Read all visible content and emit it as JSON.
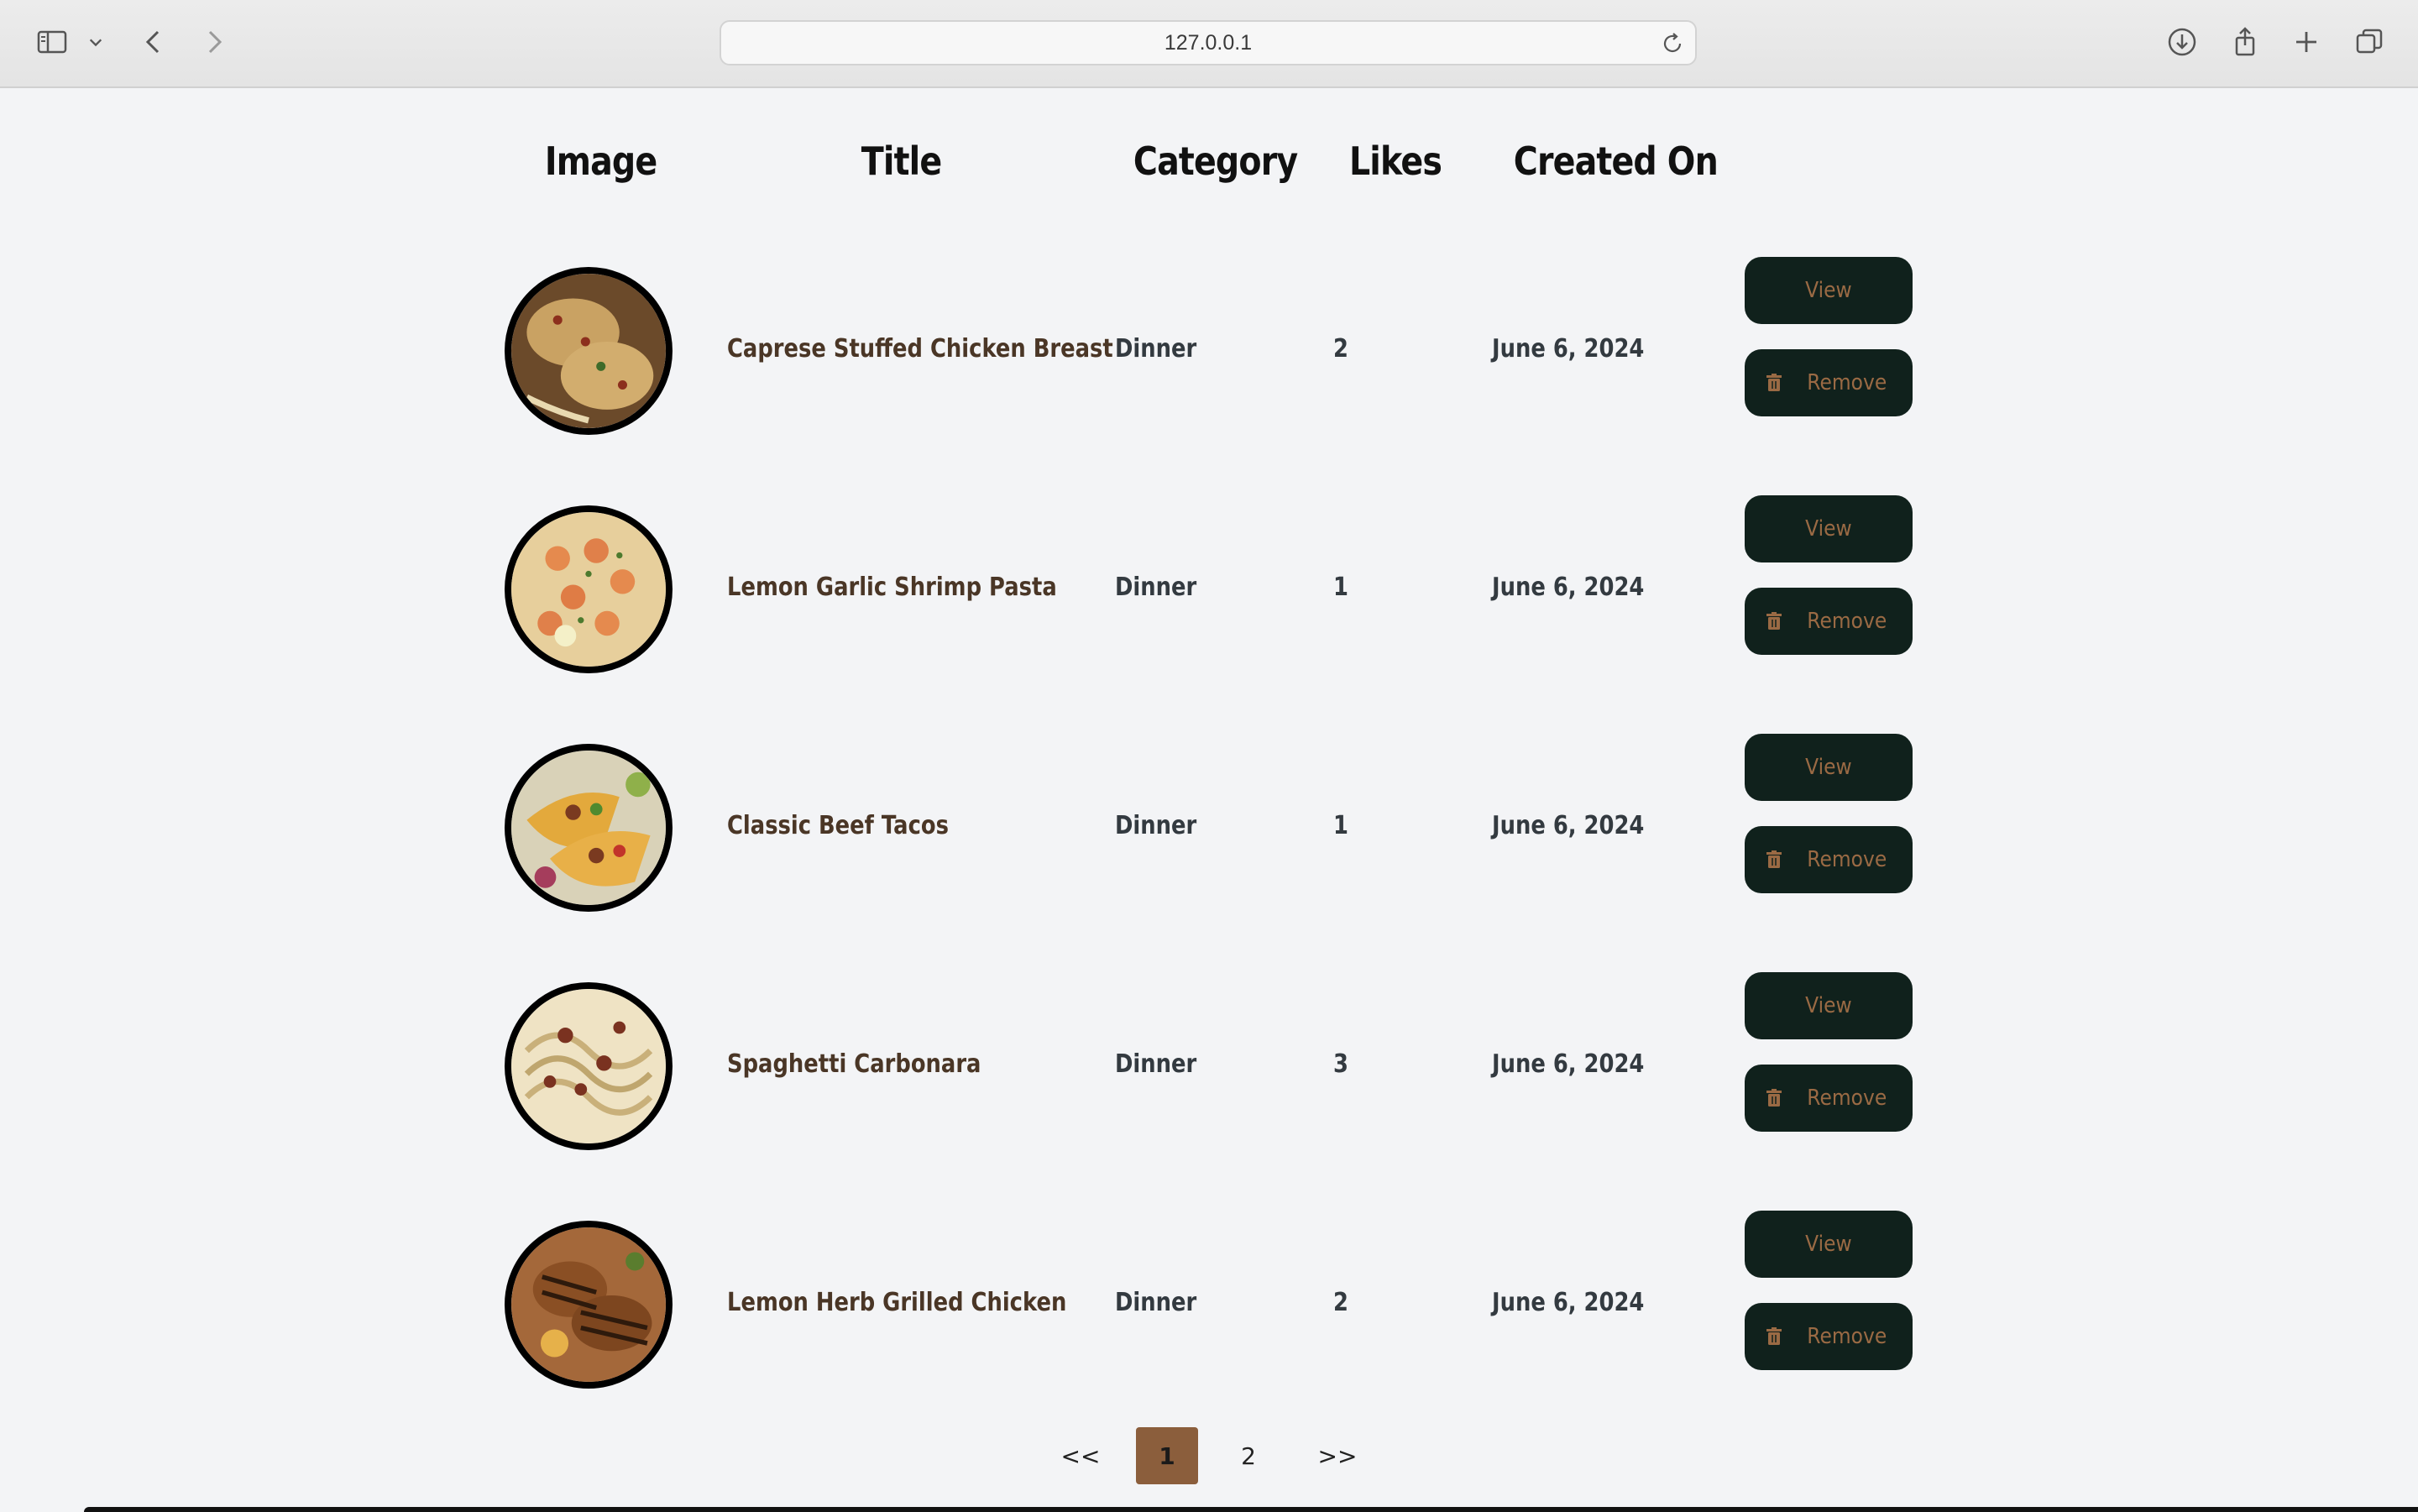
{
  "browser": {
    "url": "127.0.0.1"
  },
  "table": {
    "headers": {
      "image": "Image",
      "title": "Title",
      "category": "Category",
      "likes": "Likes",
      "created": "Created On"
    },
    "rows": [
      {
        "title": "Caprese Stuffed Chicken Breast",
        "category": "Dinner",
        "likes": "2",
        "created": "June 6, 2024",
        "image_icon": "chicken-breast-photo"
      },
      {
        "title": "Lemon Garlic Shrimp Pasta",
        "category": "Dinner",
        "likes": "1",
        "created": "June 6, 2024",
        "image_icon": "shrimp-pasta-photo"
      },
      {
        "title": "Classic Beef Tacos",
        "category": "Dinner",
        "likes": "1",
        "created": "June 6, 2024",
        "image_icon": "beef-tacos-photo"
      },
      {
        "title": "Spaghetti Carbonara",
        "category": "Dinner",
        "likes": "3",
        "created": "June 6, 2024",
        "image_icon": "carbonara-photo"
      },
      {
        "title": "Lemon Herb Grilled Chicken",
        "category": "Dinner",
        "likes": "2",
        "created": "June 6, 2024",
        "image_icon": "grilled-chicken-photo"
      }
    ],
    "actions": {
      "view_label": "View",
      "remove_label": "Remove"
    }
  },
  "pagination": {
    "prev": "<<",
    "pages": [
      "1",
      "2"
    ],
    "current": "1",
    "next": ">>"
  },
  "colors": {
    "button_bg": "#10211c",
    "button_text": "#9a6a44",
    "active_page": "#8b5e3c",
    "title_text": "#4a3626"
  }
}
